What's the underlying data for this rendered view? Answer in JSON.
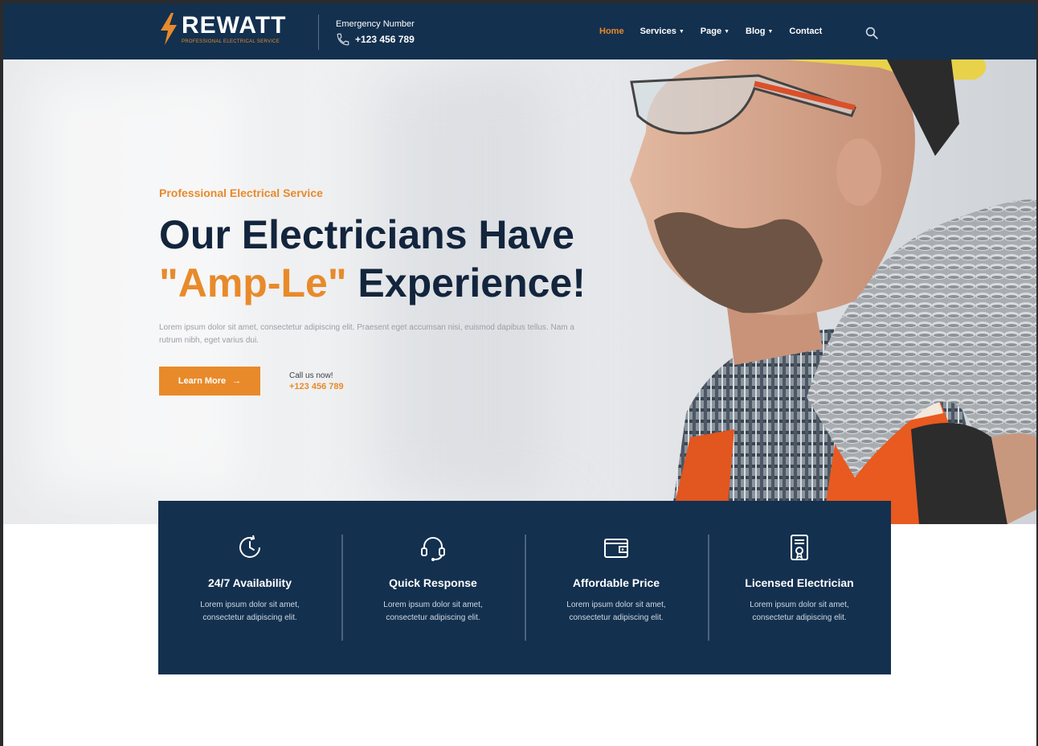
{
  "brand": {
    "name": "REWATT",
    "tagline": "PROFESSIONAL ELECTRICAL SERVICE"
  },
  "header": {
    "emergency_label": "Emergency Number",
    "emergency_phone": "+123 456 789",
    "nav": [
      {
        "label": "Home",
        "active": true
      },
      {
        "label": "Services",
        "dropdown": true
      },
      {
        "label": "Page",
        "dropdown": true
      },
      {
        "label": "Blog",
        "dropdown": true
      },
      {
        "label": "Contact"
      }
    ]
  },
  "hero": {
    "eyebrow": "Professional Electrical Service",
    "title_line1": "Our Electricians Have",
    "title_accent": "\"Amp-Le\"",
    "title_rest": " Experience!",
    "description": "Lorem ipsum dolor sit amet, consectetur adipiscing elit. Praesent eget accumsan nisi, euismod dapibus tellus. Nam a rutrum nibh, eget varius dui.",
    "cta_label": "Learn More",
    "call_label": "Call us now!",
    "call_phone": "+123 456 789"
  },
  "features": [
    {
      "icon": "clock-icon",
      "title": "24/7 Availability",
      "desc": "Lorem ipsum dolor sit amet, consectetur adipiscing elit."
    },
    {
      "icon": "headset-icon",
      "title": "Quick Response",
      "desc": "Lorem ipsum dolor sit amet, consectetur adipiscing elit."
    },
    {
      "icon": "wallet-icon",
      "title": "Affordable Price",
      "desc": "Lorem ipsum dolor sit amet, consectetur adipiscing elit."
    },
    {
      "icon": "certificate-icon",
      "title": "Licensed Electrician",
      "desc": "Lorem ipsum dolor sit amet, consectetur adipiscing elit."
    }
  ],
  "colors": {
    "navy": "#13304f",
    "accent": "#e88a2a",
    "heading": "#13253d"
  }
}
